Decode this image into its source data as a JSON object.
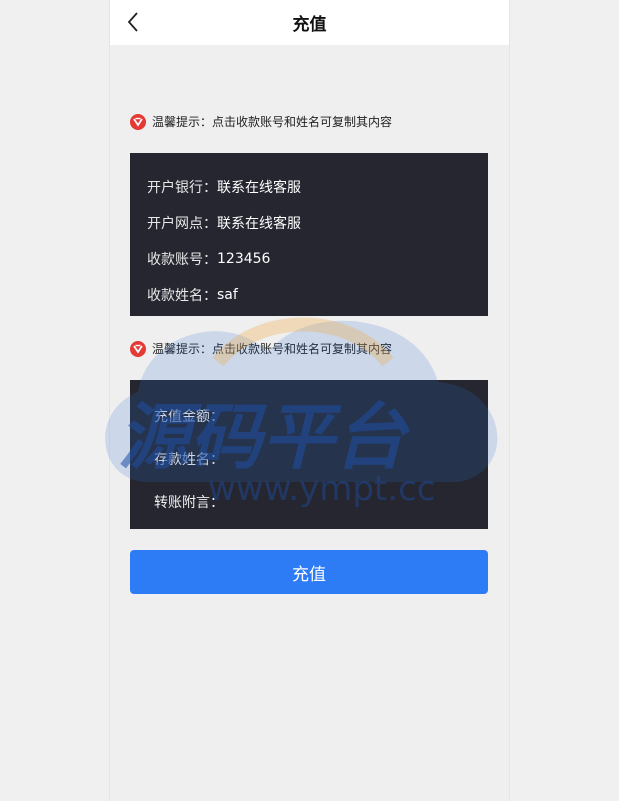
{
  "header": {
    "title": "充值"
  },
  "tips": [
    {
      "text": "温馨提示：点击收款账号和姓名可复制其内容"
    },
    {
      "text": "温馨提示：点击收款账号和姓名可复制其内容"
    }
  ],
  "account_info": {
    "rows": [
      {
        "label": "开户银行：",
        "value": "联系在线客服"
      },
      {
        "label": "开户网点：",
        "value": "联系在线客服"
      },
      {
        "label": "收款账号：",
        "value": "123456"
      },
      {
        "label": "收款姓名：",
        "value": "saf"
      }
    ]
  },
  "form": {
    "amount_label": "充值金额：",
    "amount_value": "",
    "depositor_label": "存款姓名：",
    "depositor_value": "",
    "note_label": "转账附言：",
    "note_value": ""
  },
  "submit_label": "充值",
  "watermark": {
    "title": "源码平台",
    "url": "www.ympt.cc"
  },
  "colors": {
    "card_bg": "#252630",
    "button": "#2e7bf6",
    "tip_icon": "#e53935"
  }
}
